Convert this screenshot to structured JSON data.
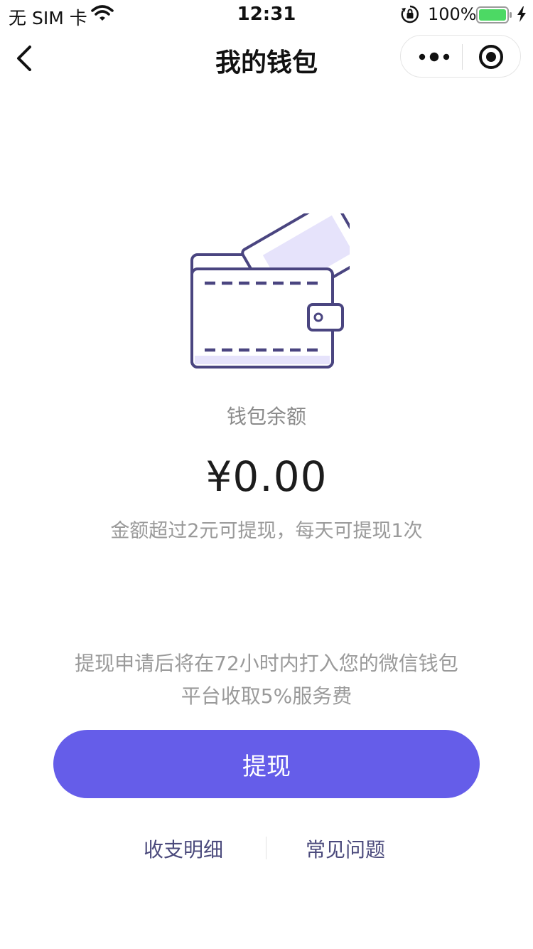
{
  "status_bar": {
    "carrier": "无 SIM 卡",
    "time": "12:31",
    "battery": "100%",
    "icons": [
      "wifi-icon",
      "orientation-lock-icon",
      "battery-icon",
      "charging-bolt-icon"
    ]
  },
  "nav": {
    "title": "我的钱包",
    "back_icon": "chevron-left-icon",
    "capsule_icons": [
      "more-dots-icon",
      "target-icon"
    ]
  },
  "wallet": {
    "illustration_icon": "wallet-icon",
    "balance_label": "钱包余额",
    "balance_amount": "¥0.00",
    "hint": "金额超过2元可提现，每天可提现1次"
  },
  "notice": {
    "line1": "提现申请后将在72小时内打入您的微信钱包",
    "line2": "平台收取5%服务费"
  },
  "actions": {
    "withdraw_label": "提现",
    "details_link": "收支明细",
    "faq_link": "常见问题"
  },
  "colors": {
    "accent": "#655de9",
    "link": "#4b4a7c",
    "illustration_stroke": "#4a4580",
    "illustration_fill": "#e6e3fb",
    "battery_green": "#4cd964"
  }
}
